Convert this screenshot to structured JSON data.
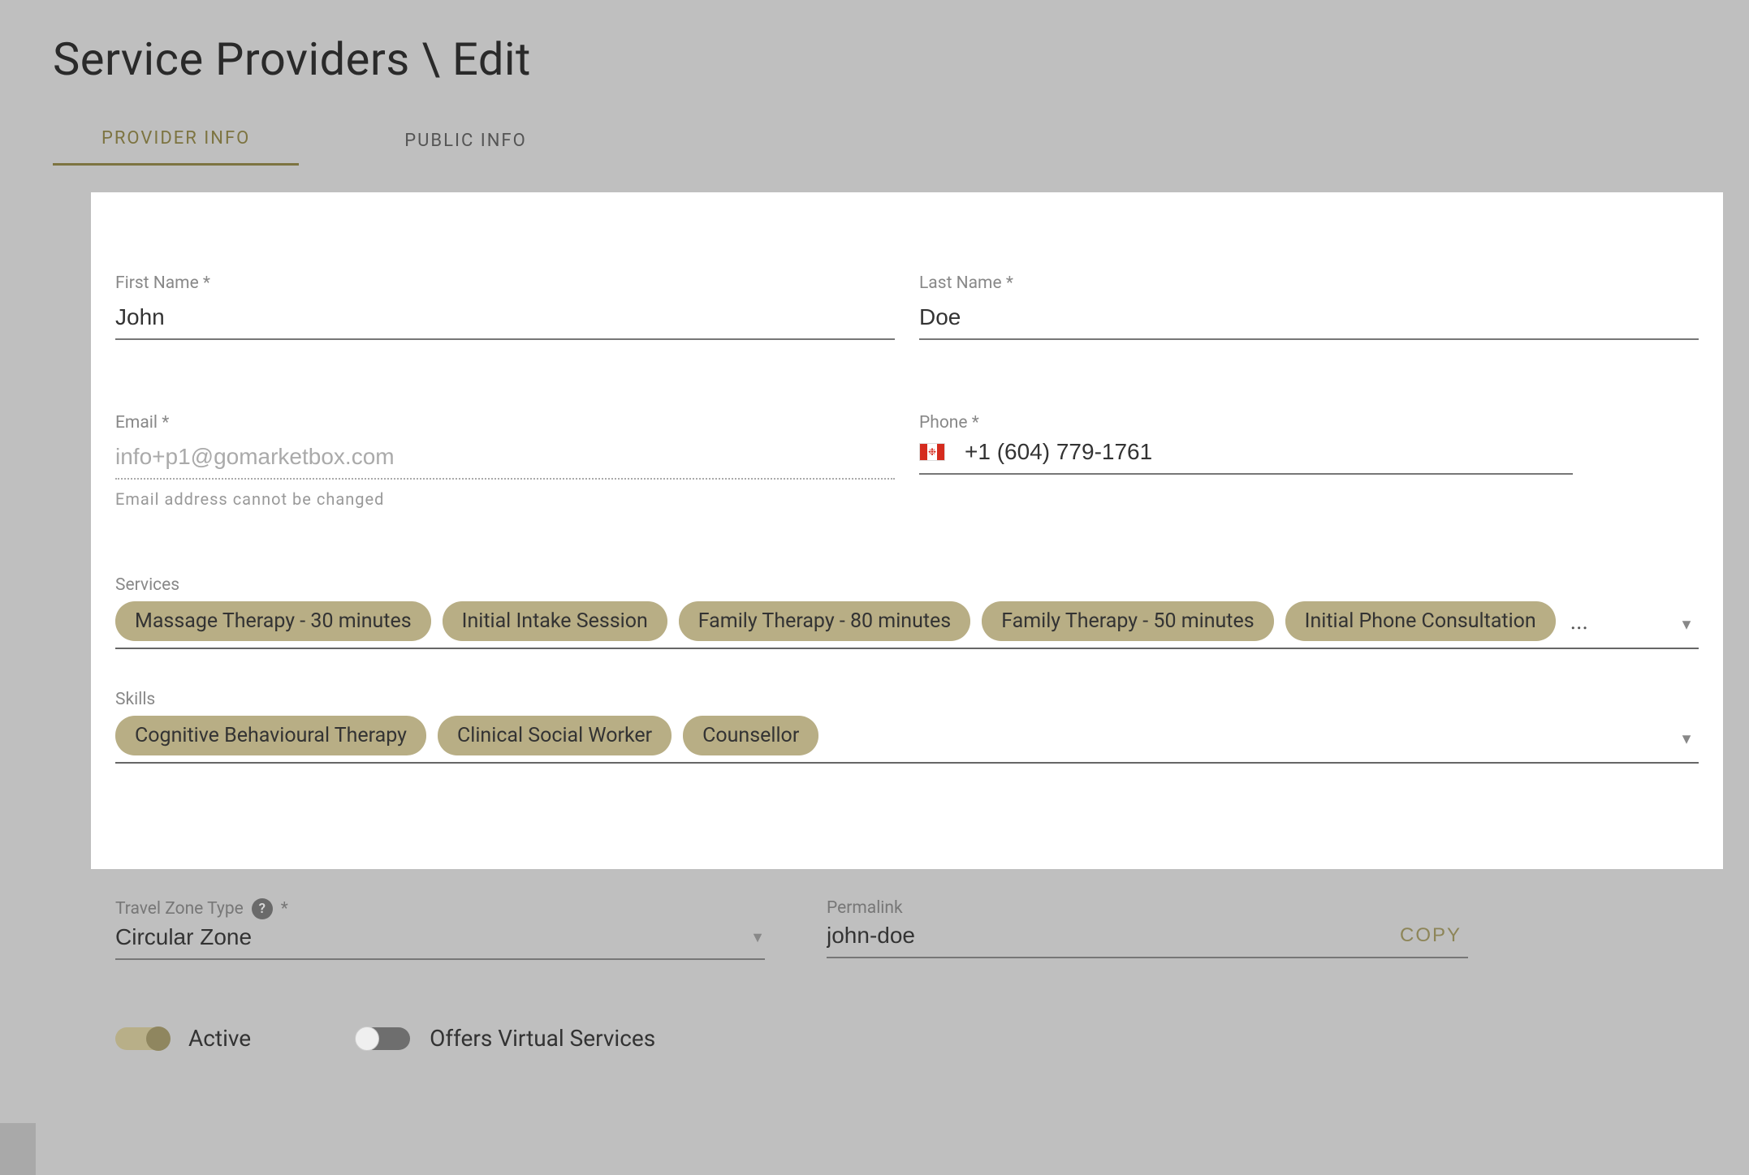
{
  "header": {
    "title": "Service Providers \\ Edit"
  },
  "tabs": [
    {
      "label": "PROVIDER INFO",
      "active": true
    },
    {
      "label": "PUBLIC INFO",
      "active": false
    }
  ],
  "fields": {
    "first_name": {
      "label": "First Name *",
      "value": "John"
    },
    "last_name": {
      "label": "Last Name *",
      "value": "Doe"
    },
    "email": {
      "label": "Email *",
      "value": "info+p1@gomarketbox.com",
      "help": "Email address cannot be changed"
    },
    "phone": {
      "label": "Phone *",
      "value": "+1 (604) 779-1761",
      "country": "CA"
    },
    "services": {
      "label": "Services",
      "chips": [
        "Massage Therapy - 30 minutes",
        "Initial Intake Session",
        "Family Therapy - 80 minutes",
        "Family Therapy - 50 minutes",
        "Initial Phone Consultation"
      ],
      "ellipsis": "..."
    },
    "skills": {
      "label": "Skills",
      "chips": [
        "Cognitive Behavioural Therapy",
        "Clinical Social Worker",
        "Counsellor"
      ]
    },
    "travel_zone": {
      "label": "Travel Zone Type",
      "required_marker": "*",
      "value": "Circular Zone"
    },
    "permalink": {
      "label": "Permalink",
      "value": "john-doe",
      "copy_label": "COPY"
    }
  },
  "toggles": {
    "active": {
      "label": "Active",
      "on": true
    },
    "virtual": {
      "label": "Offers Virtual Services",
      "on": false
    }
  }
}
